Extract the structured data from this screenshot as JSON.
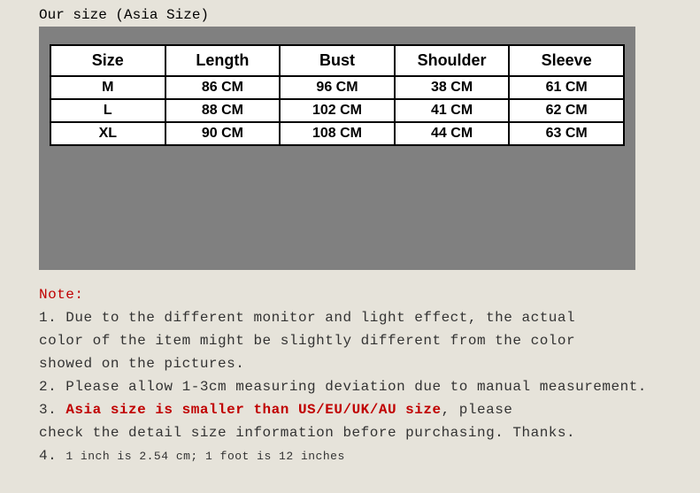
{
  "header": {
    "title": "Our size (Asia Size)"
  },
  "chart_data": {
    "type": "table",
    "title": "Our size (Asia Size)",
    "columns": [
      "Size",
      "Length",
      "Bust",
      "Shoulder",
      "Sleeve"
    ],
    "rows": [
      [
        "M",
        "86 CM",
        "96 CM",
        "38 CM",
        "61 CM"
      ],
      [
        "L",
        "88 CM",
        "102 CM",
        "41 CM",
        "62 CM"
      ],
      [
        "XL",
        "90 CM",
        "108 CM",
        "44 CM",
        "63 CM"
      ]
    ]
  },
  "notes": {
    "label": "Note:",
    "n1_a": "1. Due to the different monitor and light effect, the actual",
    "n1_b": "color of the item might be slightly different from the color",
    "n1_c": "showed on the pictures.",
    "n2": "2. Please allow 1-3cm measuring deviation due to manual measurement.",
    "n3_prefix": "3. ",
    "n3_red": "Asia size is smaller than US/EU/UK/AU size",
    "n3_suffix": ", please",
    "n3_b": "check the detail size information before purchasing. Thanks.",
    "n4_prefix": "4.  ",
    "n4_conv": "1 inch is 2.54 cm; 1 foot  is 12 inches"
  }
}
